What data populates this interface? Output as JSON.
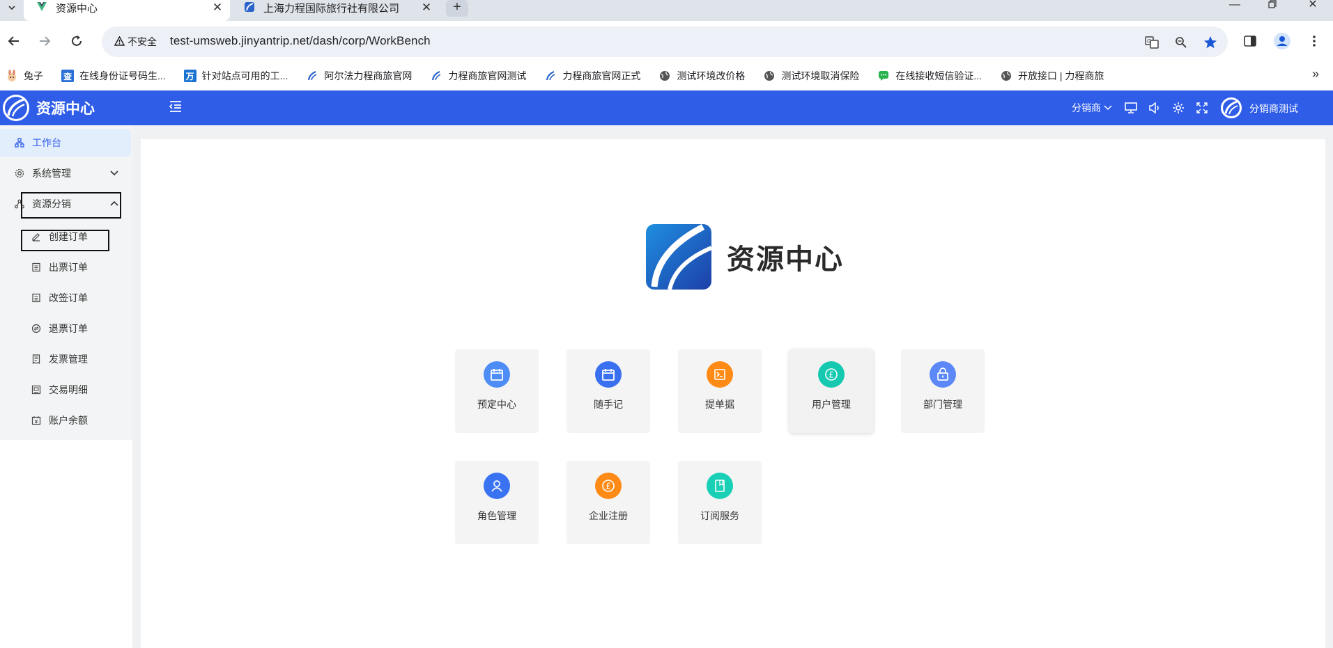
{
  "browser": {
    "tabs": [
      {
        "title": "资源中心",
        "close": "✕"
      },
      {
        "title": "上海力程国际旅行社有限公司",
        "close": "✕"
      }
    ],
    "new_tab": "+",
    "security_label": "不安全",
    "url": "test-umsweb.jinyantrip.net/dash/corp/WorkBench",
    "bookmarks": [
      {
        "label": "兔子",
        "icon": "rabbit-icon"
      },
      {
        "label": "在线身份证号码生...",
        "icon": "cha-icon"
      },
      {
        "label": "针对站点可用的工...",
        "icon": "wan-icon"
      },
      {
        "label": "阿尔法力程商旅官网",
        "icon": "liceng-logo-icon"
      },
      {
        "label": "力程商旅官网测试",
        "icon": "liceng-logo-icon"
      },
      {
        "label": "力程商旅官网正式",
        "icon": "liceng-logo-icon"
      },
      {
        "label": "测试环境改价格",
        "icon": "globe-icon"
      },
      {
        "label": "测试环境取消保险",
        "icon": "globe-icon"
      },
      {
        "label": "在线接收短信验证...",
        "icon": "message-icon"
      },
      {
        "label": "开放接口 | 力程商旅",
        "icon": "globe-icon"
      }
    ]
  },
  "app": {
    "brand": "资源中心",
    "header": {
      "role_select": "分销商",
      "user_name": "分销商测试"
    },
    "sidebar": {
      "items": [
        {
          "label": "工作台",
          "icon": "workbench-icon",
          "active": true
        },
        {
          "label": "系统管理",
          "icon": "gear-icon",
          "expanded": false
        },
        {
          "label": "资源分销",
          "icon": "distribution-icon",
          "expanded": true
        }
      ],
      "sub_items": [
        {
          "label": "创建订单",
          "icon": "edit-icon"
        },
        {
          "label": "出票订单",
          "icon": "list-icon"
        },
        {
          "label": "改签订单",
          "icon": "list-icon"
        },
        {
          "label": "退票订单",
          "icon": "refund-icon"
        },
        {
          "label": "发票管理",
          "icon": "invoice-icon"
        },
        {
          "label": "交易明细",
          "icon": "detail-icon"
        },
        {
          "label": "账户余额",
          "icon": "balance-icon"
        }
      ]
    },
    "workbench": {
      "title": "资源中心",
      "tiles": [
        {
          "label": "预定中心",
          "icon": "calendar-icon",
          "color": "#4e8df5"
        },
        {
          "label": "随手记",
          "icon": "calendar-icon",
          "color": "#3a6ff0"
        },
        {
          "label": "提单据",
          "icon": "terminal-icon",
          "color": "#ff8a16"
        },
        {
          "label": "用户管理",
          "icon": "pound-icon",
          "color": "#14c9b0"
        },
        {
          "label": "部门管理",
          "icon": "lock-icon",
          "color": "#5b87f7"
        },
        {
          "label": "角色管理",
          "icon": "user-icon",
          "color": "#3a73f2"
        },
        {
          "label": "企业注册",
          "icon": "pound-icon",
          "color": "#ff8a16"
        },
        {
          "label": "订阅服务",
          "icon": "book-icon",
          "color": "#19d0b6"
        }
      ]
    }
  }
}
